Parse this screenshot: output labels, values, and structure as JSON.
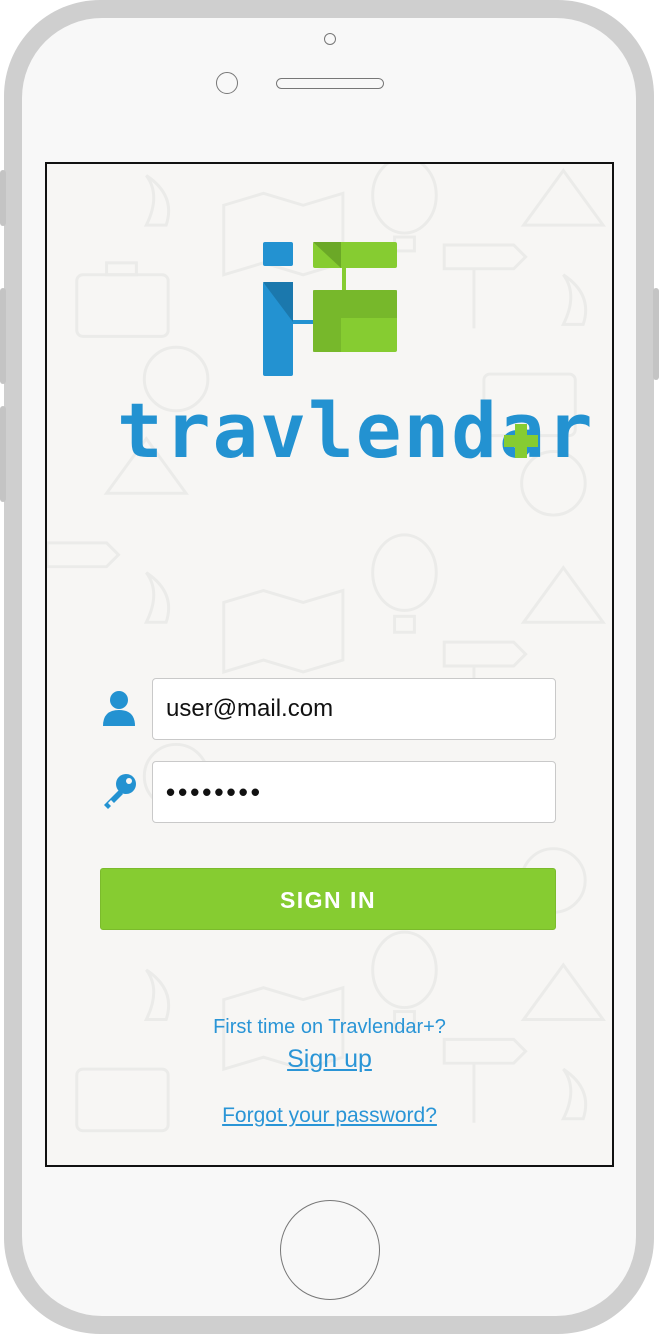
{
  "app": {
    "brand_name": "travlendar",
    "brand_accent_symbol": "+"
  },
  "login": {
    "email_value": "user@mail.com",
    "password_value": "••••••••",
    "sign_in_label": "SIGN IN"
  },
  "footer": {
    "first_time_text": "First time on Travlendar+?",
    "signup_label": "Sign up",
    "forgot_label": "Forgot your password?"
  },
  "icons": {
    "user": "user-icon",
    "key": "key-icon",
    "logo": "travlendar-logo-icon"
  },
  "colors": {
    "brand_blue": "#2392d1",
    "brand_green": "#86cc31",
    "link_blue": "#2a95d6",
    "screen_bg": "#f7f6f4"
  }
}
